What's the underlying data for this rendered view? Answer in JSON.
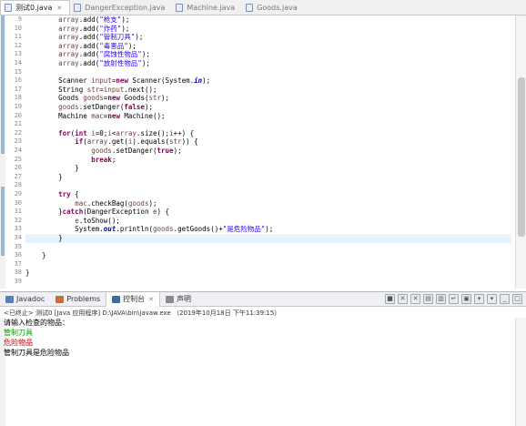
{
  "editor_tabs": [
    {
      "label": "测试0.java",
      "active": true,
      "closable": true
    },
    {
      "label": "DangerException.java",
      "active": false,
      "closable": false
    },
    {
      "label": "Machine.java",
      "active": false,
      "closable": false
    },
    {
      "label": "Goods.java",
      "active": false,
      "closable": false
    }
  ],
  "code_lines": [
    {
      "n": "9",
      "tokens": [
        {
          "t": "        "
        },
        {
          "t": "array",
          "c": "var"
        },
        {
          "t": ".add("
        },
        {
          "t": "\"枪支\"",
          "c": "str"
        },
        {
          "t": ");"
        }
      ]
    },
    {
      "n": "10",
      "tokens": [
        {
          "t": "        "
        },
        {
          "t": "array",
          "c": "var"
        },
        {
          "t": ".add("
        },
        {
          "t": "\"炸药\"",
          "c": "str"
        },
        {
          "t": ");"
        }
      ]
    },
    {
      "n": "11",
      "tokens": [
        {
          "t": "        "
        },
        {
          "t": "array",
          "c": "var"
        },
        {
          "t": ".add("
        },
        {
          "t": "\"管制刀具\"",
          "c": "str"
        },
        {
          "t": ");"
        }
      ]
    },
    {
      "n": "12",
      "tokens": [
        {
          "t": "        "
        },
        {
          "t": "array",
          "c": "var"
        },
        {
          "t": ".add("
        },
        {
          "t": "\"毒害品\"",
          "c": "str"
        },
        {
          "t": ");"
        }
      ]
    },
    {
      "n": "13",
      "tokens": [
        {
          "t": "        "
        },
        {
          "t": "array",
          "c": "var"
        },
        {
          "t": ".add("
        },
        {
          "t": "\"腐蚀性物品\"",
          "c": "str"
        },
        {
          "t": ");"
        }
      ]
    },
    {
      "n": "14",
      "tokens": [
        {
          "t": "        "
        },
        {
          "t": "array",
          "c": "var"
        },
        {
          "t": ".add("
        },
        {
          "t": "\"放射性物品\"",
          "c": "str"
        },
        {
          "t": ");"
        }
      ]
    },
    {
      "n": "15",
      "tokens": []
    },
    {
      "n": "16",
      "tokens": [
        {
          "t": "        Scanner "
        },
        {
          "t": "input",
          "c": "var"
        },
        {
          "t": "="
        },
        {
          "t": "new",
          "c": "kw"
        },
        {
          "t": " Scanner(System."
        },
        {
          "t": "in",
          "c": "fld"
        },
        {
          "t": ");"
        }
      ]
    },
    {
      "n": "17",
      "tokens": [
        {
          "t": "        String "
        },
        {
          "t": "str",
          "c": "var"
        },
        {
          "t": "="
        },
        {
          "t": "input",
          "c": "var"
        },
        {
          "t": ".next();"
        }
      ]
    },
    {
      "n": "18",
      "tokens": [
        {
          "t": "        Goods "
        },
        {
          "t": "goods",
          "c": "var"
        },
        {
          "t": "="
        },
        {
          "t": "new",
          "c": "kw"
        },
        {
          "t": " Goods("
        },
        {
          "t": "str",
          "c": "var"
        },
        {
          "t": ");"
        }
      ]
    },
    {
      "n": "19",
      "tokens": [
        {
          "t": "        "
        },
        {
          "t": "goods",
          "c": "var"
        },
        {
          "t": ".setDanger("
        },
        {
          "t": "false",
          "c": "kw"
        },
        {
          "t": ");"
        }
      ]
    },
    {
      "n": "20",
      "tokens": [
        {
          "t": "        Machine "
        },
        {
          "t": "mac",
          "c": "var"
        },
        {
          "t": "="
        },
        {
          "t": "new",
          "c": "kw"
        },
        {
          "t": " Machine();"
        }
      ]
    },
    {
      "n": "21",
      "tokens": []
    },
    {
      "n": "22",
      "tokens": [
        {
          "t": "        "
        },
        {
          "t": "for",
          "c": "kw"
        },
        {
          "t": "("
        },
        {
          "t": "int",
          "c": "kw"
        },
        {
          "t": " "
        },
        {
          "t": "i",
          "c": "var"
        },
        {
          "t": "=0;"
        },
        {
          "t": "i",
          "c": "var"
        },
        {
          "t": "<"
        },
        {
          "t": "array",
          "c": "var"
        },
        {
          "t": ".size();"
        },
        {
          "t": "i",
          "c": "var"
        },
        {
          "t": "++) {"
        }
      ]
    },
    {
      "n": "23",
      "tokens": [
        {
          "t": "            "
        },
        {
          "t": "if",
          "c": "kw"
        },
        {
          "t": "("
        },
        {
          "t": "array",
          "c": "var"
        },
        {
          "t": ".get("
        },
        {
          "t": "i",
          "c": "var"
        },
        {
          "t": ").equals("
        },
        {
          "t": "str",
          "c": "var"
        },
        {
          "t": ")) {"
        }
      ]
    },
    {
      "n": "24",
      "tokens": [
        {
          "t": "                "
        },
        {
          "t": "goods",
          "c": "var"
        },
        {
          "t": ".setDanger("
        },
        {
          "t": "true",
          "c": "kw"
        },
        {
          "t": ");"
        }
      ]
    },
    {
      "n": "25",
      "tokens": [
        {
          "t": "                "
        },
        {
          "t": "break",
          "c": "kw"
        },
        {
          "t": ";"
        }
      ]
    },
    {
      "n": "26",
      "tokens": [
        {
          "t": "            }"
        }
      ]
    },
    {
      "n": "27",
      "tokens": [
        {
          "t": "        }"
        }
      ]
    },
    {
      "n": "28",
      "tokens": []
    },
    {
      "n": "29",
      "tokens": [
        {
          "t": "        "
        },
        {
          "t": "try",
          "c": "kw"
        },
        {
          "t": " {"
        }
      ]
    },
    {
      "n": "30",
      "tokens": [
        {
          "t": "            "
        },
        {
          "t": "mac",
          "c": "var"
        },
        {
          "t": ".checkBag("
        },
        {
          "t": "goods",
          "c": "var"
        },
        {
          "t": ");"
        }
      ]
    },
    {
      "n": "31",
      "tokens": [
        {
          "t": "        }"
        },
        {
          "t": "catch",
          "c": "kw"
        },
        {
          "t": "(DangerException "
        },
        {
          "t": "e",
          "c": "var"
        },
        {
          "t": ") {"
        }
      ]
    },
    {
      "n": "32",
      "tokens": [
        {
          "t": "            "
        },
        {
          "t": "e",
          "c": "var"
        },
        {
          "t": ".toShow();"
        }
      ]
    },
    {
      "n": "33",
      "tokens": [
        {
          "t": "            System."
        },
        {
          "t": "out",
          "c": "fld"
        },
        {
          "t": ".println("
        },
        {
          "t": "goods",
          "c": "var"
        },
        {
          "t": ".getGoods()+"
        },
        {
          "t": "\"是危险物品\"",
          "c": "str"
        },
        {
          "t": ");"
        }
      ]
    },
    {
      "n": "34",
      "tokens": [
        {
          "t": "        }"
        }
      ],
      "highlight": true
    },
    {
      "n": "35",
      "tokens": []
    },
    {
      "n": "36",
      "tokens": [
        {
          "t": "    }"
        }
      ]
    },
    {
      "n": "37",
      "tokens": []
    },
    {
      "n": "38",
      "tokens": [
        {
          "t": "}"
        }
      ]
    },
    {
      "n": "39",
      "tokens": []
    }
  ],
  "panel_tabs": [
    {
      "label": "Javadoc",
      "active": false,
      "icon_color": "#5a7fb8"
    },
    {
      "label": "Problems",
      "active": false,
      "icon_color": "#c86c3c"
    },
    {
      "label": "控制台",
      "active": true,
      "icon_color": "#3c6ca8"
    },
    {
      "label": "声明",
      "active": false,
      "icon_color": "#8a8a8a"
    }
  ],
  "console_status": "<已终止> 测试0 [Java 应用程序] D:\\JAVA\\bin\\javaw.exe （2019年10月18日 下午11:39:15）",
  "console_lines": [
    {
      "text": "请输入检查的物品：",
      "color": "#000000"
    },
    {
      "text": "管制刀具",
      "color": "#00a000"
    },
    {
      "text": "危险物品",
      "color": "#c00000"
    },
    {
      "text": "管制刀具是危险物品",
      "color": "#000000"
    }
  ],
  "colors": {
    "keyword": "#7f0055",
    "string": "#2a00ff",
    "variable": "#6a3e3e",
    "field": "#0000c0",
    "input": "#00a000",
    "error": "#c00000"
  }
}
